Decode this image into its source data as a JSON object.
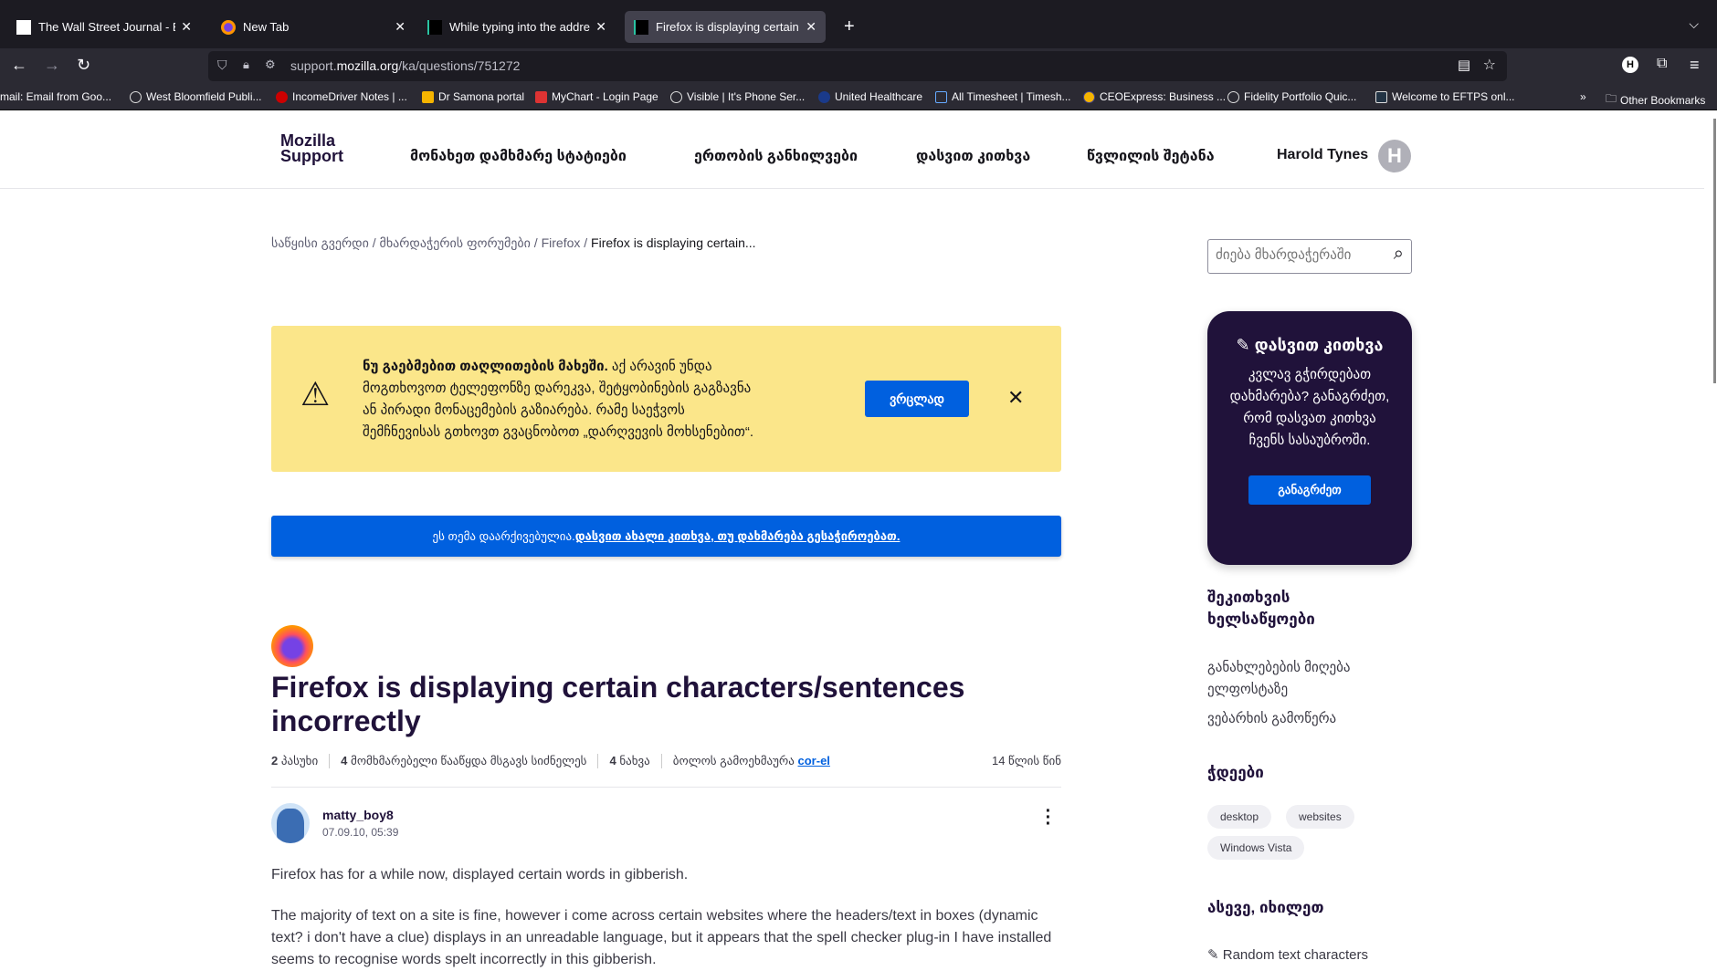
{
  "browser": {
    "tabs": [
      {
        "title": "The Wall Street Journal - Breaking",
        "icon": "wsj-icon"
      },
      {
        "title": "New Tab",
        "icon": "firefox-icon"
      },
      {
        "title": "While typing into the address bar",
        "icon": "sumo-icon"
      },
      {
        "title": "Firefox is displaying certain characters",
        "icon": "sumo-icon",
        "active": true
      }
    ],
    "url_host_prefix": "support.",
    "url_host": "mozilla.org",
    "url_path": "/ka/questions/751272",
    "bookmarks": [
      "mail: Email from Goo...",
      "West Bloomfield Publi...",
      "IncomeDriver Notes | ...",
      "Dr Samona portal",
      "MyChart - Login Page",
      "Visible | It's Phone Ser...",
      "United Healthcare",
      "All Timesheet | Timesh...",
      "CEOExpress: Business ...",
      "Fidelity Portfolio Quic...",
      "Welcome to EFTPS onl..."
    ],
    "other_bookmarks": "Other Bookmarks",
    "account_initial": "H"
  },
  "site": {
    "logo_line1": "Mozilla",
    "logo_line2": "Support",
    "nav": [
      "მონახეთ დამხმარე სტატიები",
      "ერთობის განხილვები",
      "დასვით კითხვა",
      "წვლილის შეტანა"
    ],
    "user_name": "Harold Tynes",
    "user_initial": "H"
  },
  "breadcrumb": {
    "home": "საწყისი გვერდი",
    "forums": "მხარდაჭერის ფორუმები",
    "product": "Firefox",
    "current": "Firefox is displaying certain..."
  },
  "search": {
    "placeholder": "ძიება მხარდაჭერაში"
  },
  "warning": {
    "bold": "ნუ გაებმებით თაღლითების მახეში.",
    "text": " აქ არავინ უნდა მოგთხოვოთ ტელეფონზე დარეკვა, შეტყობინების გაგზავნა ან პირადი მონაცემების გაზიარება. რამე საეჭვოს შემჩნევისას გთხოვთ გვაცნობოთ „დარღვევის მოხსენებით“.",
    "button": "ვრცლად"
  },
  "archived": {
    "text": "ეს თემა დაარქივებულია. ",
    "link": "დასვით ახალი კითხვა, თუ დახმარება გესაჭიროებათ."
  },
  "question": {
    "title": "Firefox is displaying certain characters/sentences incorrectly",
    "replies_count": "2",
    "replies_label": "პასუხი",
    "same_count": "4",
    "same_label": "მომხმარებელი წააწყდა მსგავს სიძნელეს",
    "views_count": "4",
    "views_label": "ნახვა",
    "last_reply_label": "ბოლოს გამოეხმაურა",
    "last_reply_user": "cor-el",
    "age": "14 წლის წინ",
    "author": "matty_boy8",
    "date": "07.09.10, 05:39",
    "paragraphs": [
      "Firefox has for a while now, displayed certain words in gibberish.",
      "The majority of text on a site is fine, however i come across certain websites where the headers/text in boxes (dynamic text? i don't have a clue) displays in an unreadable language, but it appears that the spell checker plug-in I have installed seems to recognise words spelt incorrectly in this gibberish."
    ]
  },
  "sidebar": {
    "card_title": "დასვით კითხვა",
    "card_text": "კვლავ გჭირდებათ დახმარება? განაგრძეთ, რომ დასვათ კითხვა ჩვენს სასაუბროში.",
    "card_button": "განაგრძეთ",
    "tools_heading": "შეკითხვის ხელსაწყოები",
    "tools": [
      "განახლებების მიღება ელფოსტაზე",
      "ვებარხის გამოწერა"
    ],
    "tags_heading": "ჭდეები",
    "tags": [
      "desktop",
      "websites",
      "Windows Vista"
    ],
    "see_also_heading": "ასევე, იხილეთ",
    "see_also": [
      "Random text characters"
    ]
  }
}
